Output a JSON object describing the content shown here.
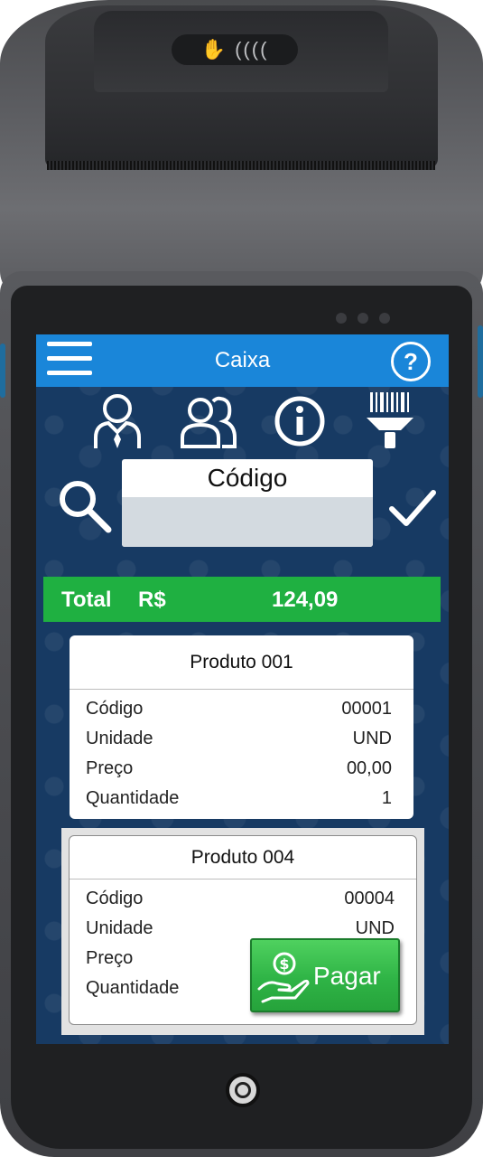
{
  "app": {
    "title": "Caixa",
    "help_label": "?"
  },
  "toolbar": {
    "icons": [
      "user-tie-icon",
      "users-icon",
      "info-icon",
      "barcode-scanner-icon"
    ]
  },
  "search": {
    "label": "Código",
    "value": "",
    "placeholder": ""
  },
  "total": {
    "label": "Total",
    "currency": "R$",
    "value": "124,09"
  },
  "products": [
    {
      "name": "Produto 001",
      "rows": [
        {
          "label": "Código",
          "value": "00001"
        },
        {
          "label": "Unidade",
          "value": "UND"
        },
        {
          "label": "Preço",
          "value": "00,00"
        },
        {
          "label": "Quantidade",
          "value": "1"
        }
      ]
    },
    {
      "name": "Produto 004",
      "rows": [
        {
          "label": "Código",
          "value": "00004"
        },
        {
          "label": "Unidade",
          "value": "UND"
        },
        {
          "label": "Preço",
          "value": ""
        },
        {
          "label": "Quantidade",
          "value": ""
        }
      ]
    }
  ],
  "pay": {
    "label": "Pagar",
    "icon": "hand-money-icon"
  },
  "colors": {
    "app_bar": "#1a86d9",
    "screen_bg": "#173a63",
    "total_bar": "#1fb041",
    "pay_button": "#2fb446"
  }
}
